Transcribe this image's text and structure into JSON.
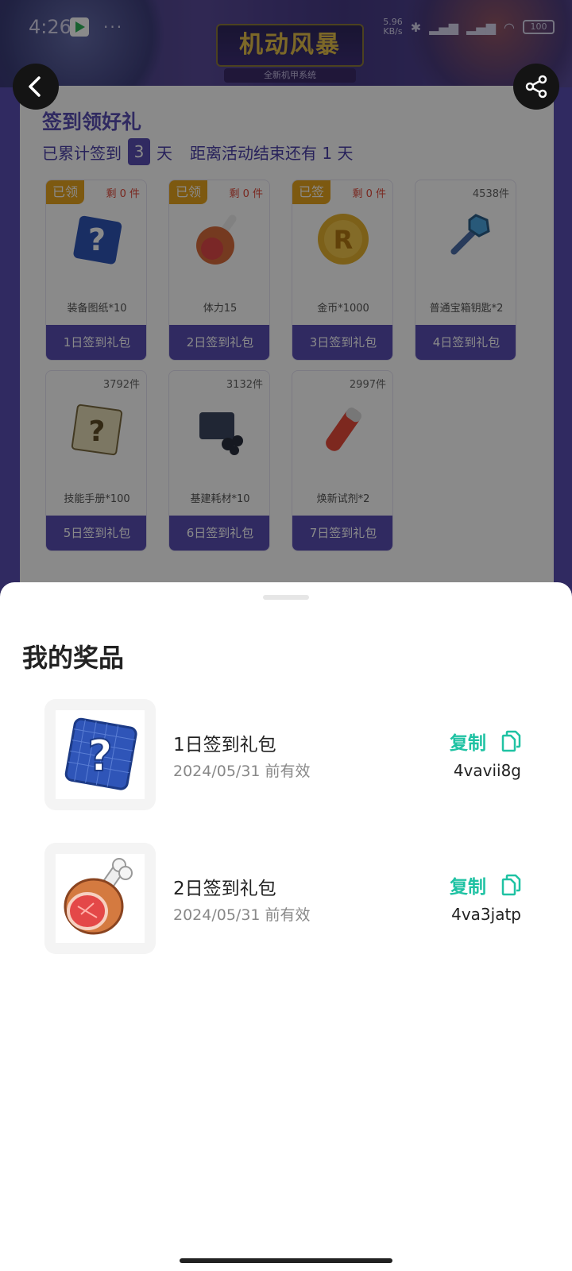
{
  "status_bar": {
    "time": "4:26",
    "dots": "···",
    "net_speed_value": "5.96",
    "net_speed_unit": "KB/s",
    "battery": "100"
  },
  "banner": {
    "title": "机动风暴",
    "subtitle": "全新机甲系统"
  },
  "card": {
    "title": "签到领好礼",
    "count_prefix": "已累计签到",
    "count_value": "3",
    "count_suffix": "天",
    "remaining_text": "距离活动结束还有 1 天"
  },
  "rewards": [
    {
      "tag": "已领",
      "stock": "剩 0 件",
      "name": "装备图纸*10",
      "button": "1日签到礼包"
    },
    {
      "tag": "已领",
      "stock": "剩 0 件",
      "name": "体力15",
      "button": "2日签到礼包"
    },
    {
      "tag": "已签",
      "stock": "剩 0 件",
      "name": "金币*1000",
      "button": "3日签到礼包"
    },
    {
      "tag": "",
      "stock": "4538件",
      "name": "普通宝箱钥匙*2",
      "button": "4日签到礼包"
    },
    {
      "tag": "",
      "stock": "3792件",
      "name": "技能手册*100",
      "button": "5日签到礼包"
    },
    {
      "tag": "",
      "stock": "3132件",
      "name": "基建耗材*10",
      "button": "6日签到礼包"
    },
    {
      "tag": "",
      "stock": "2997件",
      "name": "焕新试剂*2",
      "button": "7日签到礼包"
    }
  ],
  "sheet": {
    "title": "我的奖品",
    "prizes": [
      {
        "name": "1日签到礼包",
        "expiry": "2024/05/31 前有效",
        "copy_label": "复制",
        "code": "4vavii8g"
      },
      {
        "name": "2日签到礼包",
        "expiry": "2024/05/31 前有效",
        "copy_label": "复制",
        "code": "4va3jatp"
      }
    ]
  },
  "colors": {
    "accent_purple": "#5a4fb3",
    "copy_green": "#1fc2a3",
    "tag_orange": "#e8a51e",
    "stock_red": "#e0493a"
  }
}
